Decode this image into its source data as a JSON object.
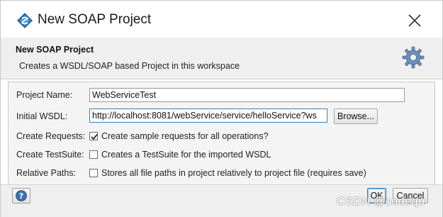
{
  "window": {
    "title": "New SOAP Project"
  },
  "header": {
    "title": "New SOAP Project",
    "description": "Creates a WSDL/SOAP based Project in this workspace"
  },
  "form": {
    "project_name": {
      "label": "Project Name:",
      "value": "WebServiceTest"
    },
    "initial_wsdl": {
      "label": "Initial WSDL:",
      "value": "http://localhost:8081/webService/service/helloService?ws",
      "browse_label": "Browse..."
    },
    "create_requests": {
      "label": "Create Requests:",
      "checked": true,
      "option_text": "Create sample requests for all operations?"
    },
    "create_testsuite": {
      "label": "Create TestSuite:",
      "checked": false,
      "option_text": "Creates a TestSuite for the imported WSDL"
    },
    "relative_paths": {
      "label": "Relative Paths:",
      "checked": false,
      "option_text": "Stores all file paths in project relatively to project file (requires save)"
    }
  },
  "footer": {
    "ok_label": "OK",
    "cancel_label": "Cancel"
  },
  "watermark": "CSDN @codequ",
  "colors": {
    "accent_focus": "#3c7fb1",
    "header_bg": "#efefef",
    "form_bg": "#f4f4f4"
  },
  "icons": [
    "soapui-logo-icon",
    "close-icon",
    "gear-icon",
    "help-icon",
    "checkmark-icon"
  ]
}
